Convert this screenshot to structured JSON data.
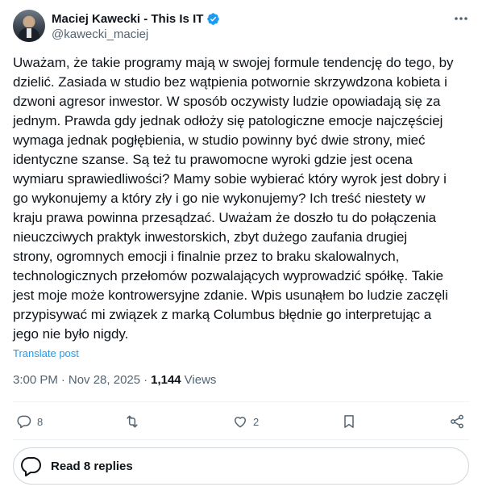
{
  "author": {
    "display_name": "Maciej Kawecki - This Is IT",
    "handle": "@kawecki_maciej",
    "verified": true
  },
  "tweet": {
    "text": "Uważam, że takie programy mają w swojej formule tendencję do tego, by\ndzielić. Zasiada w studio bez wątpienia potwornie skrzywdzona kobieta i\ndzwoni agresor inwestor. W sposób oczywisty ludzie opowiadają się za\njednym. Prawda gdy jednak odłoży się patologiczne emocje najczęściej\nwymaga jednak pogłębienia, w studio powinny być dwie strony, mieć\nidentyczne szanse. Są też tu prawomocne wyroki gdzie jest ocena\nwymiaru sprawiedliwości? Mamy sobie wybierać który wyrok jest dobry i\ngo wykonujemy a który zły i go nie wykonujemy? Ich treść niestety w\nkraju prawa powinna przesądzać. Uważam że doszło tu do połączenia\nnieuczciwych praktyk inwestorskich, zbyt dużego zaufania drugiej\nstrony, ogromnych emocji i finalnie przez to braku skalowalnych,\ntechnologicznych przełomów pozwalających wyprowadzić spółkę. Takie\njest moje może kontrowersyjne zdanie. Wpis usunąłem bo ludzie zaczęli\nprzypisywać mi związek z marką Columbus błędnie go interpretując a\njego nie było nigdy.",
    "translate_label": "Translate post",
    "time": "3:00 PM",
    "date": "Nov 28, 2025",
    "separator": "·",
    "views_count": "1,144",
    "views_label": "Views"
  },
  "actions": {
    "reply_count": "8",
    "repost_count": "",
    "like_count": "2",
    "icons": [
      "reply-icon",
      "repost-icon",
      "like-icon",
      "bookmark-icon",
      "share-icon"
    ]
  },
  "read_replies_label": "Read 8 replies",
  "colors": {
    "text": "#0f1419",
    "secondary": "#536471",
    "accent": "#1d9bf0",
    "border": "#cfd9de"
  }
}
